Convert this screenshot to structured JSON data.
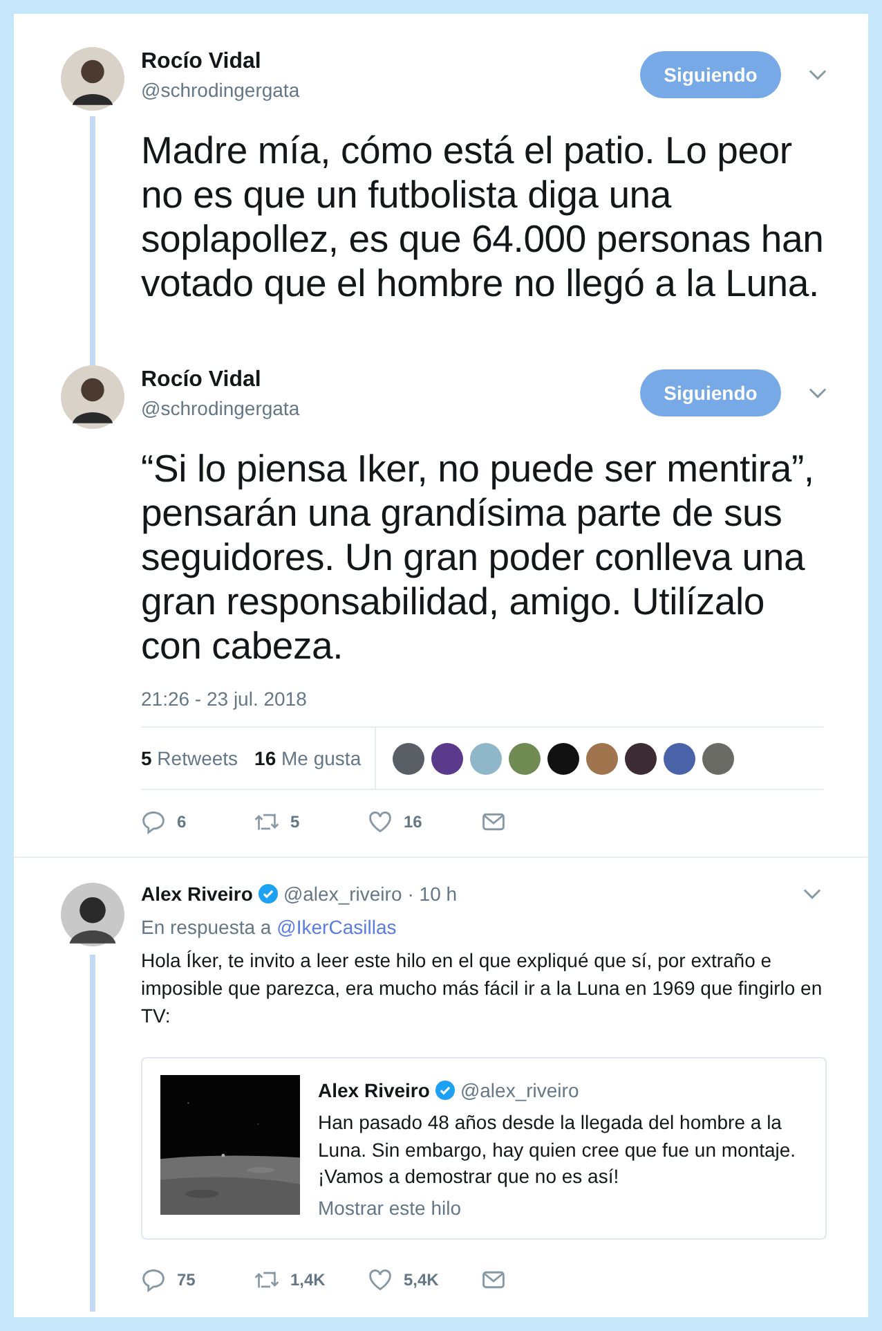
{
  "main_tweets": [
    {
      "author": {
        "name": "Rocío Vidal",
        "handle": "@schrodingergata"
      },
      "follow_button": "Siguiendo",
      "in_thread": true,
      "text": "Madre mía, cómo está el patio. Lo peor no es que un futbolista diga una soplapollez, es que 64.000 personas han votado que el hombre no llegó a la Luna."
    },
    {
      "author": {
        "name": "Rocío Vidal",
        "handle": "@schrodingergata"
      },
      "follow_button": "Siguiendo",
      "in_thread": false,
      "text": "“Si lo piensa Iker, no puede ser mentira”, pensarán una grandísima parte de sus seguidores. Un gran poder conlleva una gran responsabilidad, amigo. Utilízalo con cabeza."
    }
  ],
  "timestamp": "21:26 - 23 jul. 2018",
  "stats": [
    {
      "count": "5",
      "label": "Retweets"
    },
    {
      "count": "16",
      "label": "Me gusta"
    }
  ],
  "likers": [
    {
      "color": "#5a5f66"
    },
    {
      "color": "#5b3a8c"
    },
    {
      "color": "#8fb7c9"
    },
    {
      "color": "#6f8a52"
    },
    {
      "color": "#111111"
    },
    {
      "color": "#a0744c"
    },
    {
      "color": "#3d2c33"
    },
    {
      "color": "#4a63a8"
    },
    {
      "color": "#6b6b66"
    }
  ],
  "main_actions": [
    {
      "kind": "reply",
      "count": "6"
    },
    {
      "kind": "retweet",
      "count": "5"
    },
    {
      "kind": "like",
      "count": "16"
    },
    {
      "kind": "message"
    }
  ],
  "reply": {
    "author": {
      "name": "Alex Riveiro",
      "handle": "@alex_riveiro",
      "verified": true
    },
    "time": "· 10 h",
    "in_thread": true,
    "in_reply_label": "En respuesta a",
    "in_reply_to": "@IkerCasillas",
    "text": "Hola Íker, te invito a leer este hilo en el que expliqué que sí, por extraño e imposible que parezca, era mucho más fácil ir a la Luna en 1969 que fingirlo en TV:",
    "quote": {
      "kind": "picture",
      "author": {
        "name": "Alex Riveiro",
        "handle": "@alex_riveiro",
        "verified": true
      },
      "text": "Han pasado 48 años desde la llegada del hombre a la Luna. Sin embargo, hay quien cree que fue un montaje. ¡Vamos a demostrar que no es así!",
      "link": "Mostrar este hilo"
    },
    "actions": [
      {
        "kind": "reply",
        "count": "75"
      },
      {
        "kind": "retweet",
        "count": "1,4K"
      },
      {
        "kind": "like",
        "count": "5,4K"
      },
      {
        "kind": "message"
      }
    ]
  }
}
